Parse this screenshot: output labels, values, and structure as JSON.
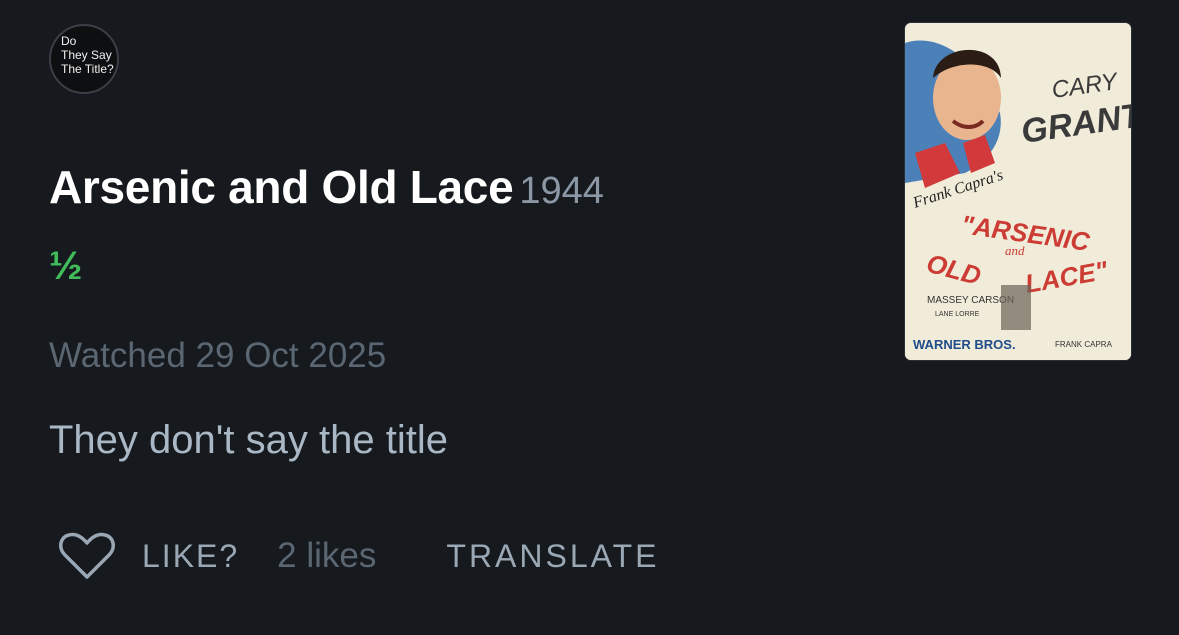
{
  "avatar": {
    "lines": [
      "Do",
      "They Say",
      "The Title?"
    ]
  },
  "film": {
    "title": "Arsenic and Old Lace",
    "year": "1944",
    "rating": "½"
  },
  "entry": {
    "watched": "Watched 29 Oct 2025",
    "review": "They don't say the title"
  },
  "actions": {
    "like_label": "LIKE?",
    "likes_count": "2 likes",
    "translate_label": "TRANSLATE"
  },
  "poster": {
    "top_name_1": "CARY",
    "top_name_2": "GRANT",
    "director_credit": "Frank Capra's",
    "title_word_1": "\"ARSENIC",
    "title_word_2": "OLD",
    "title_word_and": "and",
    "title_word_3": "LACE\"",
    "cast_1": "MASSEY CARSON",
    "cast_2": "LANE LORRE",
    "studio": "WARNER BROS.",
    "director": "FRANK CAPRA"
  },
  "colors": {
    "background": "#16191e",
    "rating_green": "#40bc5a",
    "title_white": "#ffffff",
    "muted": "#5b6673"
  }
}
